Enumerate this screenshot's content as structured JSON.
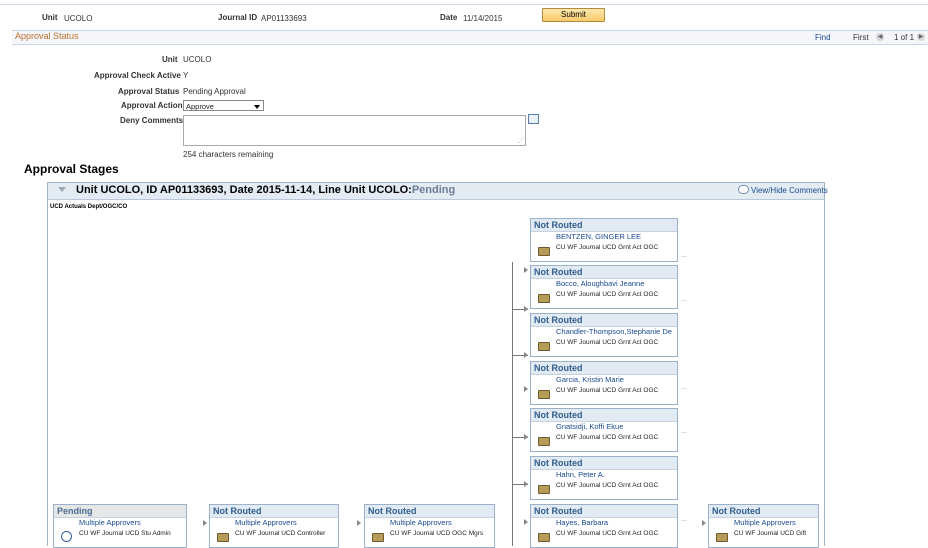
{
  "header": {
    "unit_label": "Unit",
    "unit_value": "UCOLO",
    "journal_label": "Journal ID",
    "journal_value": "AP01133693",
    "date_label": "Date",
    "date_value": "11/14/2015",
    "submit_label": "Submit"
  },
  "approval_status": {
    "section_title": "Approval Status",
    "find_label": "Find",
    "first_label": "First",
    "page_label": "1 of 1",
    "unit_label": "Unit",
    "unit_value": "UCOLO",
    "check_active_label": "Approval Check Active",
    "check_active_value": "Y",
    "status_label": "Approval Status",
    "status_value": "Pending Approval",
    "action_label": "Approval Action",
    "action_value": "Approve",
    "deny_label": "Deny Comments",
    "deny_value": "",
    "chars_remaining": "254 characters remaining"
  },
  "stages": {
    "title": "Approval Stages",
    "header_prefix": "Unit UCOLO, ID AP01133693, Date 2015-11-14, Line Unit UCOLO:",
    "header_status": "Pending",
    "view_hide_label": "View/Hide Comments",
    "path_name": "UCD Actuals Dept/OGC/CO",
    "right_cards": [
      {
        "status": "Not Routed",
        "name": "BENTZEN, GINGER LEE",
        "role": "CU WF Journal UCD Grnt Act OGC"
      },
      {
        "status": "Not Routed",
        "name": "Bocco, Aloughbavi Jeanne",
        "role": "CU WF Journal UCD Grnt Act OGC"
      },
      {
        "status": "Not Routed",
        "name": "Chandler-Thompson,Stephanie De",
        "role": "CU WF Journal UCD Grnt Act OGC"
      },
      {
        "status": "Not Routed",
        "name": "Garcia, Kristin Marie",
        "role": "CU WF Journal UCD Grnt Act OGC"
      },
      {
        "status": "Not Routed",
        "name": "Gnatsidji, Koffi Ekue",
        "role": "CU WF Journal UCD Grnt Act OGC"
      },
      {
        "status": "Not Routed",
        "name": "Hahn, Peter A.",
        "role": "CU WF Journal UCD Grnt Act OGC"
      },
      {
        "status": "Not Routed",
        "name": "Hayes, Barbara",
        "role": "CU WF Journal UCD Grnt Act OGC"
      }
    ],
    "bottom_cards": [
      {
        "status": "Pending",
        "name": "Multiple Approvers",
        "role": "CU WF Journal UCD Stu Admin"
      },
      {
        "status": "Not Routed",
        "name": "Multiple Approvers",
        "role": "CU WF Journal UCD Controller"
      },
      {
        "status": "Not Routed",
        "name": "Multiple Approvers",
        "role": "CU WF Journal UCD OGC Mgrs"
      },
      {
        "status": "Not Routed",
        "name": "Multiple Approvers",
        "role": "CU WF Journal UCD Gift"
      }
    ],
    "dash_glyph": "..."
  },
  "colors": {
    "link": "#1a4a8e",
    "section_title": "#c0702e",
    "card_header": "#e2ebf4",
    "card_status": "#2f5d8c"
  },
  "icons": [
    "approver-icon",
    "clock-icon",
    "comment-bubble-icon",
    "collapse-icon",
    "expand-icon",
    "nav-arrow-icon"
  ]
}
